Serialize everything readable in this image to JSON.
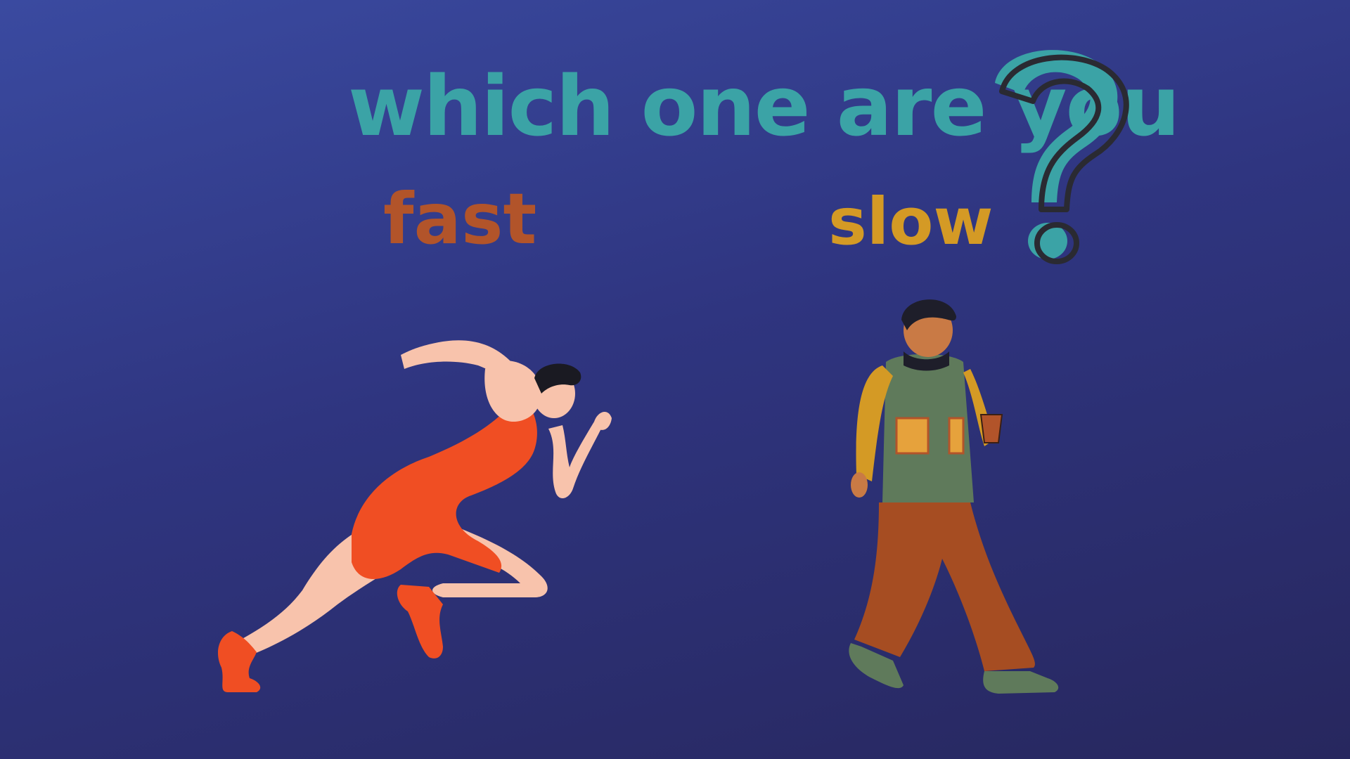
{
  "title": "which one are you",
  "options": {
    "fast_label": "fast",
    "slow_label": "slow"
  },
  "icons": {
    "question": "question-mark-icon",
    "runner": "sprinter-illustration",
    "walker": "walking-man-illustration"
  },
  "colors": {
    "background_top": "#3a4aa0",
    "background_bottom": "#27275e",
    "title": "#3ba3a6",
    "fast": "#b2542a",
    "slow": "#d49a25",
    "runner_suit": "#f04e23",
    "walker_jacket": "#5f7a5b",
    "walker_pants": "#a64d22"
  }
}
